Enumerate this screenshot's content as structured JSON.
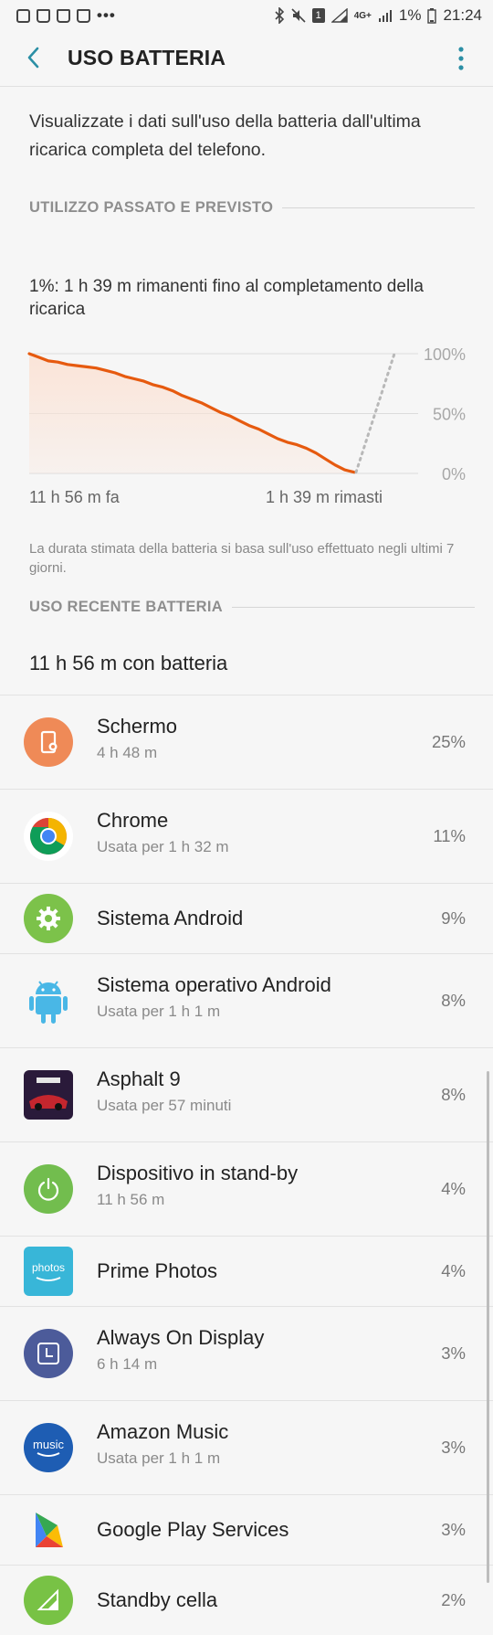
{
  "status_bar": {
    "battery_pct": "1%",
    "time": "21:24",
    "network": "4G+"
  },
  "app_bar": {
    "title": "USO BATTERIA"
  },
  "intro": "Visualizzate i dati sull'uso della batteria dall'ultima ricarica completa del telefono.",
  "sections": {
    "past_forecast": "UTILIZZO PASSATO E PREVISTO",
    "recent_usage": "USO RECENTE BATTERIA"
  },
  "remaining_text": "1%: 1 h 39 m rimanenti fino al completamento della ricarica",
  "chart_data": {
    "type": "line",
    "x_labels": [
      "11 h 56 m fa",
      "1 h 39 m rimasti"
    ],
    "y_ticks": [
      "100%",
      "50%",
      "0%"
    ],
    "ylim": [
      0,
      100
    ],
    "series": [
      {
        "values": [
          100,
          97,
          94,
          93,
          91,
          90,
          89,
          88,
          86,
          84,
          81,
          79,
          77,
          74,
          72,
          69,
          65,
          62,
          59,
          55,
          51,
          48,
          44,
          40,
          37,
          33,
          29,
          26,
          24,
          21,
          17,
          12,
          7,
          3,
          1
        ]
      }
    ],
    "forecast": {
      "from": 1,
      "to": 100
    },
    "colors": {
      "line": "#e65a0f",
      "fill": "#fbe3d6",
      "forecast": "#b8b8b8"
    }
  },
  "note": "La durata stimata della batteria si basa sull'uso effettuato negli ultimi 7 giorni.",
  "battery_time": "11 h 56 m con batteria",
  "apps": [
    {
      "name": "Schermo",
      "sub": "4 h 48 m",
      "pct": "25%",
      "icon": "screen-icon",
      "color": "#ef8a57"
    },
    {
      "name": "Chrome",
      "sub": "Usata per 1 h 32 m",
      "pct": "11%",
      "icon": "chrome-icon",
      "color": "#ffffff"
    },
    {
      "name": "Sistema Android",
      "sub": "",
      "pct": "9%",
      "icon": "gear-icon",
      "color": "#7cc24a"
    },
    {
      "name": "Sistema operativo Android",
      "sub": "Usata per 1 h 1 m",
      "pct": "8%",
      "icon": "android-icon",
      "color": "#f6f6f6"
    },
    {
      "name": "Asphalt 9",
      "sub": "Usata per 57 minuti",
      "pct": "8%",
      "icon": "asphalt-icon",
      "color": "#2a1a3a"
    },
    {
      "name": "Dispositivo in stand-by",
      "sub": "11 h 56 m",
      "pct": "4%",
      "icon": "power-icon",
      "color": "#72bd4e"
    },
    {
      "name": "Prime Photos",
      "sub": "",
      "pct": "4%",
      "icon": "prime-photos-icon",
      "color": "#38b6d8"
    },
    {
      "name": "Always On Display",
      "sub": "6 h 14 m",
      "pct": "3%",
      "icon": "clock-icon",
      "color": "#4c5b9a"
    },
    {
      "name": "Amazon Music",
      "sub": "Usata per 1 h 1 m",
      "pct": "3%",
      "icon": "music-icon",
      "color": "#1e5db3"
    },
    {
      "name": "Google Play Services",
      "sub": "",
      "pct": "3%",
      "icon": "puzzle-icon",
      "color": "#f6f6f6"
    },
    {
      "name": "Standby cella",
      "sub": "",
      "pct": "2%",
      "icon": "signal-icon",
      "color": "#78c245"
    }
  ]
}
